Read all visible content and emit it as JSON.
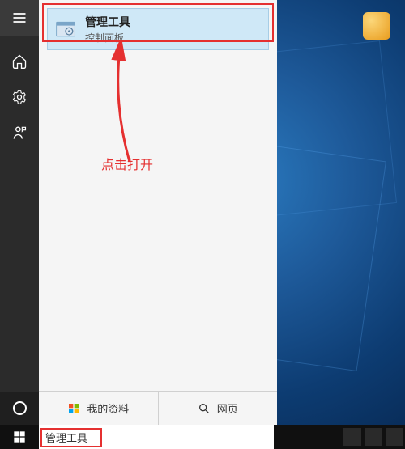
{
  "best_match": {
    "title": "管理工具",
    "subtitle": "控制面板"
  },
  "annotation": {
    "label": "点击打开"
  },
  "tabs": {
    "tab1": "我的资料",
    "tab2": "网页"
  },
  "search": {
    "value": "管理工具"
  },
  "colors": {
    "highlight": "#e53030",
    "selected_bg": "#cfe8f7"
  }
}
